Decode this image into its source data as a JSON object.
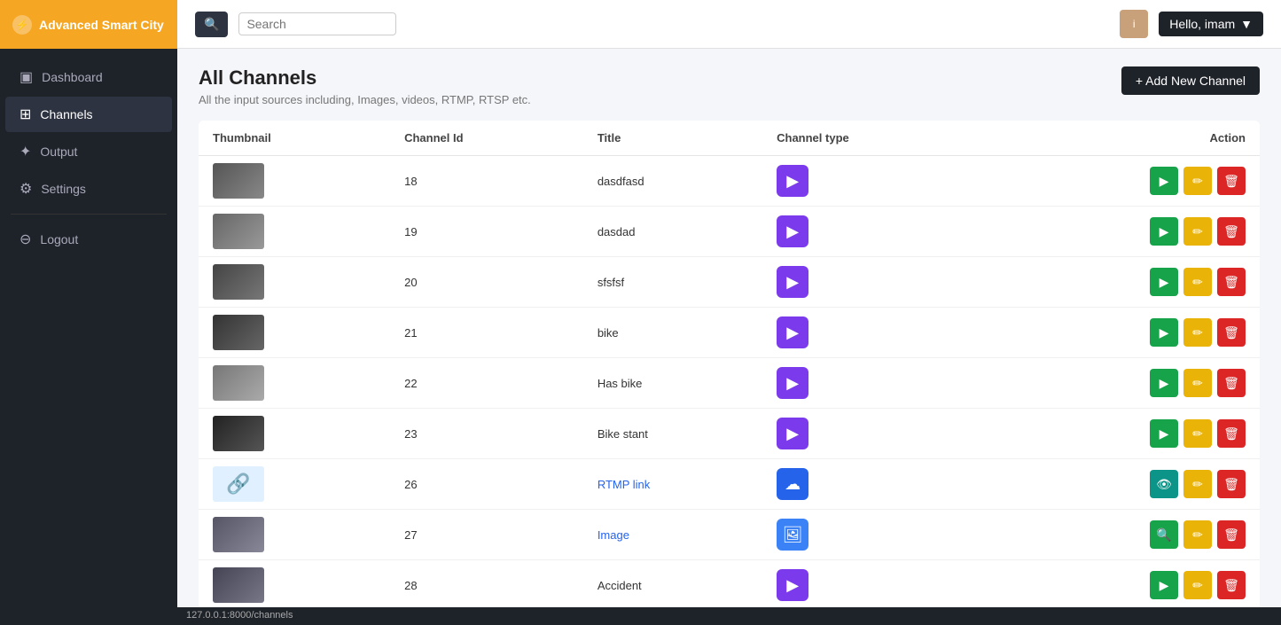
{
  "app": {
    "title": "Advanced Smart City",
    "logo_icon": "⚙"
  },
  "sidebar": {
    "items": [
      {
        "id": "dashboard",
        "label": "Dashboard",
        "icon": "▪",
        "active": false
      },
      {
        "id": "channels",
        "label": "Channels",
        "icon": "◈",
        "active": true
      },
      {
        "id": "output",
        "label": "Output",
        "icon": "✦",
        "active": false
      },
      {
        "id": "settings",
        "label": "Settings",
        "icon": "⚙",
        "active": false
      }
    ],
    "logout_label": "Logout"
  },
  "topbar": {
    "search_placeholder": "Search",
    "user_greeting": "Hello, imam",
    "user_initial": "i"
  },
  "page": {
    "title": "All Channels",
    "subtitle": "All the input sources including, Images, videos, RTMP, RTSP etc.",
    "add_button_label": "+ Add New Channel"
  },
  "table": {
    "headers": [
      "Thumbnail",
      "Channel Id",
      "Title",
      "Channel type",
      "Action"
    ],
    "rows": [
      {
        "id": 18,
        "title": "dasdfasd",
        "channel_type": "video",
        "thumb_class": "thumb-1"
      },
      {
        "id": 19,
        "title": "dasdad",
        "channel_type": "video",
        "thumb_class": "thumb-2"
      },
      {
        "id": 20,
        "title": "sfsfsf",
        "channel_type": "video",
        "thumb_class": "thumb-3"
      },
      {
        "id": 21,
        "title": "bike",
        "channel_type": "video",
        "thumb_class": "thumb-4"
      },
      {
        "id": 22,
        "title": "Has bike",
        "channel_type": "video",
        "thumb_class": "thumb-5"
      },
      {
        "id": 23,
        "title": "Bike stant",
        "channel_type": "video",
        "thumb_class": "thumb-6"
      },
      {
        "id": 26,
        "title": "RTMP link",
        "channel_type": "rtmp",
        "thumb_class": "thumb-link"
      },
      {
        "id": 27,
        "title": "Image",
        "channel_type": "image",
        "thumb_class": "thumb-7"
      },
      {
        "id": 28,
        "title": "Accident",
        "channel_type": "video",
        "thumb_class": "thumb-8"
      }
    ]
  },
  "status_bar": {
    "url": "127.0.0.1:8000/channels"
  }
}
